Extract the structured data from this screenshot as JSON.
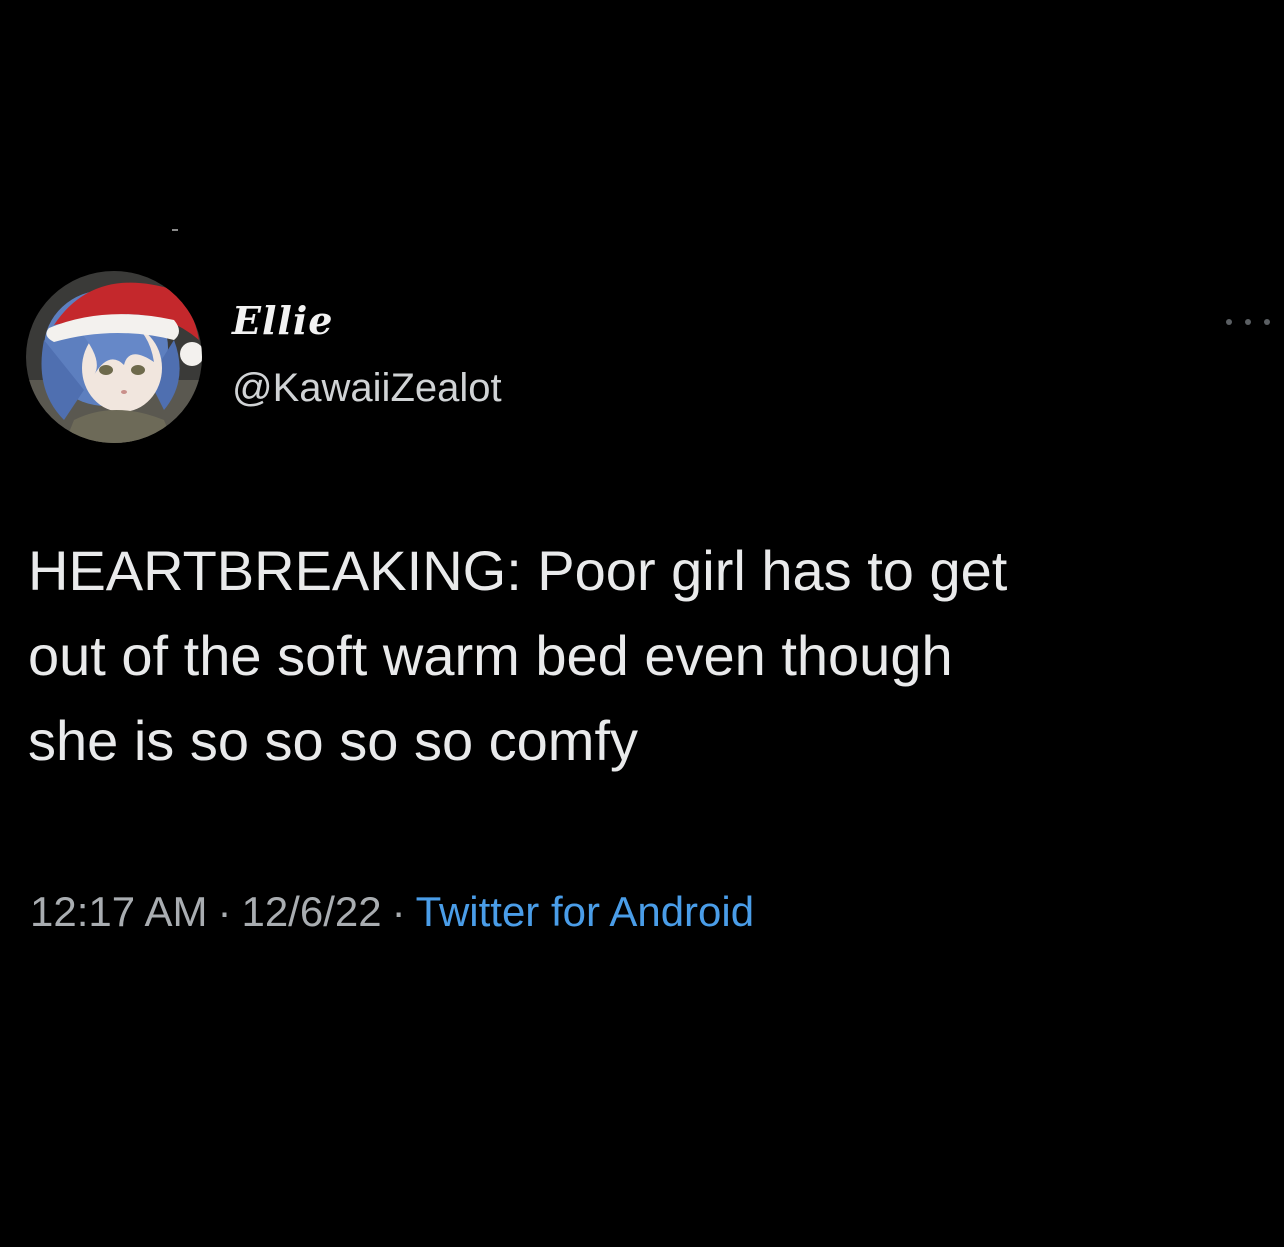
{
  "tweet": {
    "display_name": "Ellie",
    "handle": "@KawaiiZealot",
    "text_lines": [
      "HEARTBREAKING: Poor girl has to get",
      "out of the soft warm bed even though",
      "she is so so so so comfy"
    ],
    "time": "12:17 AM",
    "date": "12/6/22",
    "separator": "·",
    "source": "Twitter for Android"
  },
  "icons": {
    "more": "more-options-icon",
    "avatar": "avatar-image"
  },
  "colors": {
    "background": "#000000",
    "text": "#e7e9ea",
    "meta": "#a9adb1",
    "link": "#4a9de8"
  }
}
